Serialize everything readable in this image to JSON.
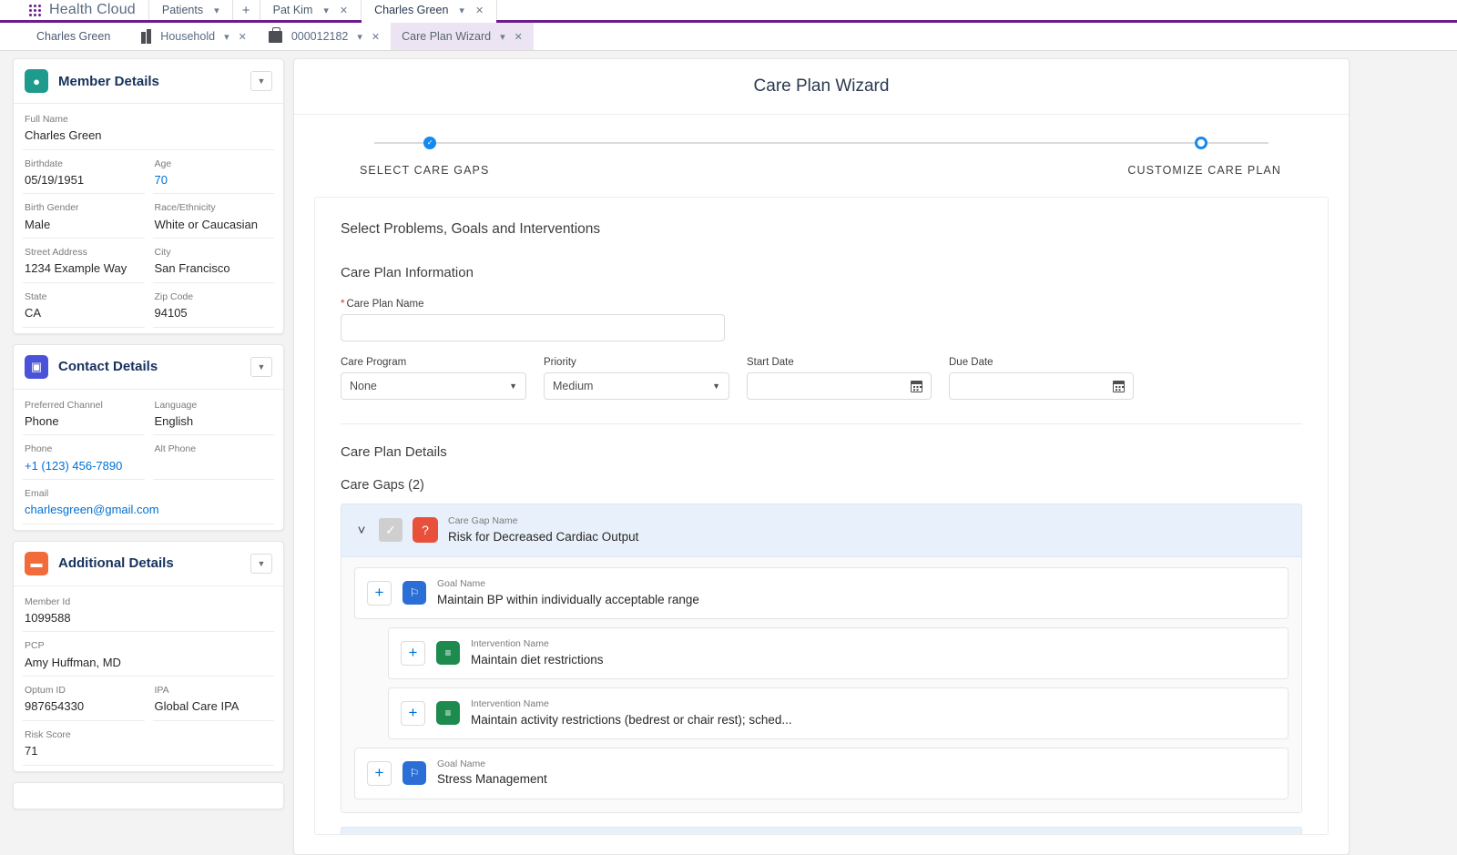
{
  "app": {
    "brand": "Health Cloud",
    "launcher_icon": "app-launcher-waffle-icon"
  },
  "global_tabs": [
    {
      "label": "Patients",
      "active": false,
      "closable": false
    },
    {
      "label": "Pat Kim",
      "active": false,
      "closable": true
    },
    {
      "label": "Charles Green",
      "active": true,
      "closable": true
    }
  ],
  "global_add_label": "+",
  "sub_tabs": {
    "anchor": "Charles Green",
    "items": [
      {
        "label": "Household",
        "icon": "building-icon",
        "active": false
      },
      {
        "label": "000012182",
        "icon": "case-icon",
        "active": false
      },
      {
        "label": "Care Plan Wizard",
        "icon": "",
        "active": true
      }
    ]
  },
  "sidebar": {
    "cards": [
      {
        "title": "Member Details",
        "icon": "person-badge-icon",
        "icon_color": "#1f9b8e",
        "icon_glyph": "▢",
        "rows": [
          [
            {
              "label": "Full Name",
              "value": "Charles Green",
              "link": false
            }
          ],
          [
            {
              "label": "Birthdate",
              "value": "05/19/1951",
              "link": false
            },
            {
              "label": "Age",
              "value": "70",
              "link": true
            }
          ],
          [
            {
              "label": "Birth Gender",
              "value": "Male",
              "link": false
            },
            {
              "label": "Race/Ethnicity",
              "value": "White or Caucasian",
              "link": false
            }
          ],
          [
            {
              "label": "Street Address",
              "value": "1234 Example Way",
              "link": false
            },
            {
              "label": "City",
              "value": "San Francisco",
              "link": false
            }
          ],
          [
            {
              "label": "State",
              "value": "CA",
              "link": false
            },
            {
              "label": "Zip Code",
              "value": "94105",
              "link": false
            }
          ]
        ]
      },
      {
        "title": "Contact Details",
        "icon": "contact-card-icon",
        "icon_color": "#4a52d8",
        "icon_glyph": "▤",
        "rows": [
          [
            {
              "label": "Preferred Channel",
              "value": "Phone",
              "link": false
            },
            {
              "label": "Language",
              "value": "English",
              "link": false
            }
          ],
          [
            {
              "label": "Phone",
              "value": "+1 (123) 456-7890",
              "link": true
            },
            {
              "label": "Alt Phone",
              "value": "",
              "link": false
            }
          ],
          [
            {
              "label": "Email",
              "value": "charlesgreen@gmail.com",
              "link": true
            }
          ]
        ]
      },
      {
        "title": "Additional Details",
        "icon": "briefcase-icon",
        "icon_color": "#f26b3a",
        "icon_glyph": "▬",
        "rows": [
          [
            {
              "label": "Member Id",
              "value": "1099588",
              "link": false
            }
          ],
          [
            {
              "label": "PCP",
              "value": "Amy Huffman, MD",
              "link": false
            }
          ],
          [
            {
              "label": "Optum ID",
              "value": "987654330",
              "link": false
            },
            {
              "label": "IPA",
              "value": "Global Care IPA",
              "link": false
            }
          ],
          [
            {
              "label": "Risk Score",
              "value": "71",
              "link": false
            }
          ]
        ]
      }
    ],
    "collapse_icon": "chevron-down-icon"
  },
  "wizard": {
    "title": "Care Plan Wizard",
    "steps": [
      {
        "label": "SELECT  CARE GAPS",
        "state": "done"
      },
      {
        "label": "CUSTOMIZE CARE PLAN",
        "state": "current"
      }
    ],
    "lead": "Select Problems, Goals and Interventions",
    "info_section_title": "Care Plan Information",
    "fields": {
      "care_plan_name": {
        "label": "Care Plan Name",
        "required_marker": "*",
        "value": "",
        "placeholder": ""
      },
      "care_program": {
        "label": "Care Program",
        "value": "None"
      },
      "priority": {
        "label": "Priority",
        "value": "Medium"
      },
      "start_date": {
        "label": "Start Date",
        "value": "",
        "placeholder": ""
      },
      "due_date": {
        "label": "Due Date",
        "value": "",
        "placeholder": ""
      }
    },
    "details_section_title": "Care Plan Details",
    "care_gaps_heading": "Care Gaps (2)",
    "care_gap": {
      "sub_label": "Care Gap Name",
      "name": "Risk for Decreased Cardiac Output",
      "expand_icon": "chevron-down-icon",
      "checkbox_icon": "check-icon",
      "gap_icon": "care-gap-icon",
      "gap_icon_color": "#e8503a",
      "children": [
        {
          "type": "goal",
          "sub_label": "Goal Name",
          "name": "Maintain BP within individually acceptable range",
          "icon": "goal-flag-icon",
          "icon_color": "#2b6fd6",
          "add_label": "+"
        },
        {
          "type": "intervention",
          "sub_label": "Intervention Name",
          "name": "Maintain diet restrictions",
          "icon": "intervention-checklist-icon",
          "icon_color": "#1d8a4e",
          "add_label": "+"
        },
        {
          "type": "intervention",
          "sub_label": "Intervention Name",
          "name": "Maintain activity restrictions (bedrest or chair rest); sched...",
          "icon": "intervention-checklist-icon",
          "icon_color": "#1d8a4e",
          "add_label": "+"
        },
        {
          "type": "goal",
          "sub_label": "Goal Name",
          "name": "Stress Management",
          "icon": "goal-flag-icon",
          "icon_color": "#2b6fd6",
          "add_label": "+"
        }
      ]
    }
  },
  "colors": {
    "brand_purple": "#6b1d8c",
    "link_blue": "#0070d2",
    "step_blue": "#1589ee",
    "gap_row_bg": "#e8f1fb",
    "required_red": "#c23934"
  }
}
